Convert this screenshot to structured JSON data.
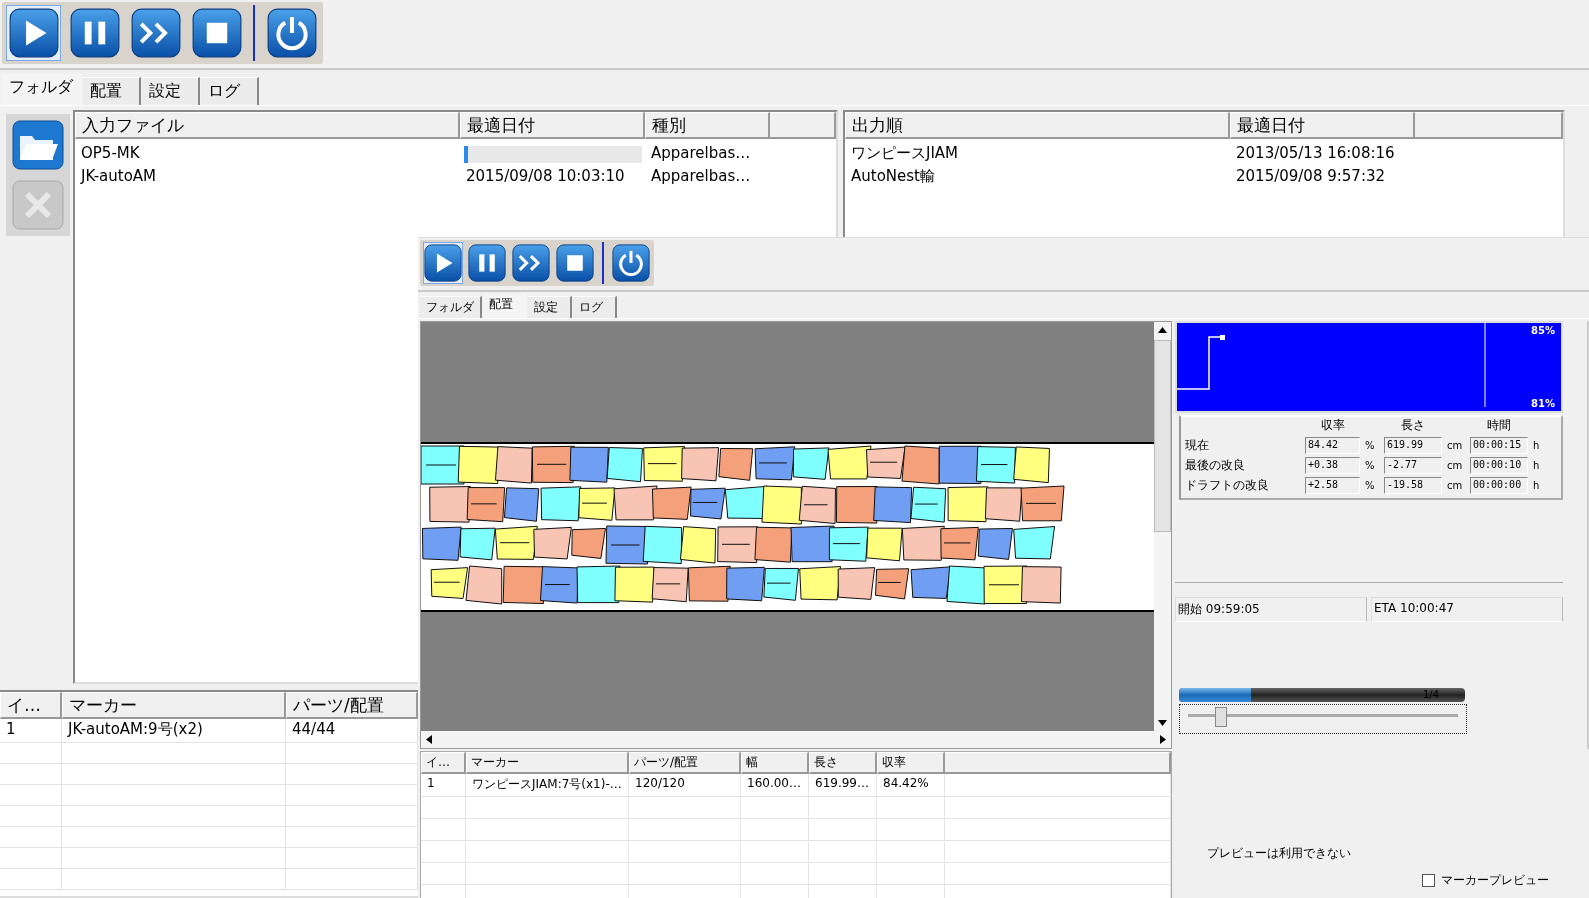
{
  "main_window": {
    "toolbar": [
      {
        "kind": "play",
        "focused": true
      },
      {
        "kind": "pause",
        "focused": false
      },
      {
        "kind": "fast_forward",
        "focused": false
      },
      {
        "kind": "stop",
        "focused": false
      },
      {
        "kind": "power",
        "focused": false
      }
    ],
    "tabs": [
      {
        "label": "フォルダ",
        "selected": true
      },
      {
        "label": "配置",
        "selected": false
      },
      {
        "label": "設定",
        "selected": false
      },
      {
        "label": "ログ",
        "selected": false
      }
    ],
    "side_buttons": [
      {
        "kind": "open_folder",
        "disabled": false
      },
      {
        "kind": "delete",
        "disabled": true
      }
    ],
    "input_table": {
      "columns": [
        "入力ファイル",
        "最適日付",
        "種別"
      ],
      "rows": [
        {
          "file": "OP5-MK",
          "progress": {
            "level": 0.02
          },
          "type": "Apparelbas…"
        },
        {
          "file": "JK-autoAM",
          "date": "2015/09/08 10:03:10",
          "type": "Apparelbas…"
        }
      ]
    },
    "output_table": {
      "columns": [
        "出力順",
        "最適日付"
      ],
      "rows": [
        {
          "name": "ワンピースJIAM",
          "date": "2013/05/13 16:08:16"
        },
        {
          "name": "AutoNest輸",
          "date": "2015/09/08 9:57:32"
        }
      ]
    },
    "marker_table": {
      "columns": [
        "イ…",
        "マーカー",
        "パーツ/配置"
      ],
      "rows": [
        [
          "1",
          "JK-autoAM:9号(x2)",
          "44/44"
        ]
      ]
    }
  },
  "nest_window": {
    "toolbar": [
      {
        "kind": "play",
        "focused": true
      },
      {
        "kind": "pause",
        "focused": false
      },
      {
        "kind": "fast_forward",
        "focused": false
      },
      {
        "kind": "stop",
        "focused": false
      },
      {
        "kind": "power",
        "focused": false
      }
    ],
    "tabs": [
      {
        "label": "フォルダ",
        "selected": false
      },
      {
        "label": "配置",
        "selected": true
      },
      {
        "label": "設定",
        "selected": false
      },
      {
        "label": "ログ",
        "selected": false
      }
    ],
    "chart": {
      "top_label": "85%",
      "bottom_label": "81%"
    },
    "stats": {
      "columns": [
        "収率",
        "長さ",
        "時間"
      ],
      "rows": [
        {
          "label": "現在",
          "rate": "84.42",
          "rate_unit": "%",
          "length": "619.99",
          "length_unit": "cm",
          "time": "00:00:15",
          "time_unit": "h"
        },
        {
          "label": "最後の改良",
          "rate": "+0.38",
          "rate_unit": "%",
          "length": "-2.77",
          "length_unit": "cm",
          "time": "00:00:10",
          "time_unit": "h"
        },
        {
          "label": "ドラフトの改良",
          "rate": "+2.58",
          "rate_unit": "%",
          "length": "-19.58",
          "length_unit": "cm",
          "time": "00:00:00",
          "time_unit": "h"
        }
      ]
    },
    "start": "開始 09:59:05",
    "eta": "ETA 10:00:47",
    "progress": {
      "level": 0.25,
      "text": "1/4"
    },
    "zoom_slider": {
      "level": 0.12
    },
    "marker_table": {
      "columns": [
        "イ…",
        "マーカー",
        "パーツ/配置",
        "幅",
        "長さ",
        "収率"
      ],
      "rows": [
        [
          "1",
          "ワンピースJIAM:7号(x1)-…",
          "120/120",
          "160.00…",
          "619.99…",
          "84.42%"
        ]
      ]
    },
    "preview": {
      "message": "プレビューは利用できない",
      "checkbox": {
        "label": "マーカープレビュー",
        "checked": false
      }
    }
  }
}
